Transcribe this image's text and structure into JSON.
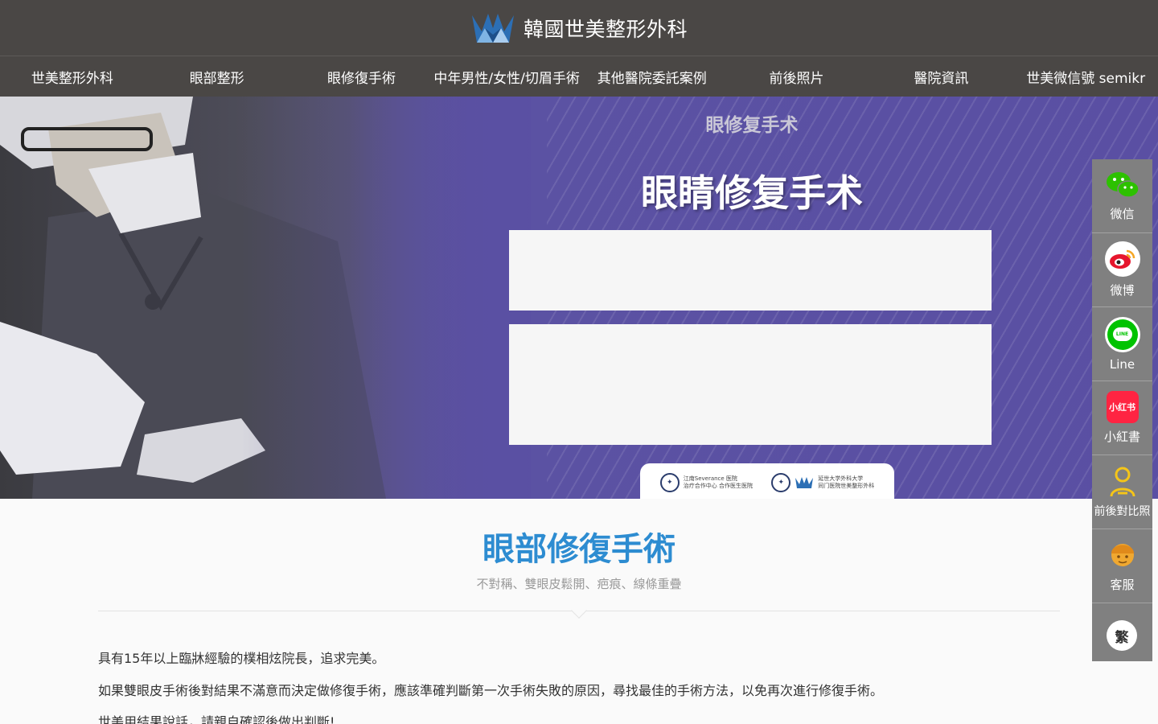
{
  "header": {
    "brand_name": "韓國世美整形外科",
    "logo_icon": "crown-logo-icon"
  },
  "nav": {
    "items": [
      {
        "label": "世美整形外科"
      },
      {
        "label": "眼部整形"
      },
      {
        "label": "眼修復手術"
      },
      {
        "label": "中年男性/女性/切眉手術"
      },
      {
        "label": "其他醫院委託案例"
      },
      {
        "label": "前後照片"
      },
      {
        "label": "醫院資訊"
      },
      {
        "label": "世美微信號 semikr"
      }
    ]
  },
  "hero": {
    "kicker": "眼修复手术",
    "title": "眼睛修复手术",
    "partners": [
      {
        "name": "江南Severance 医院",
        "line2": "治疗合作中心 合作医生医院"
      },
      {
        "name": "延世大学外科大学",
        "line2": "同门医院世美整形外科"
      }
    ]
  },
  "section": {
    "title": "眼部修復手術",
    "subtitle": "不對稱、雙眼皮鬆開、疤痕、線條重疊",
    "paragraphs": [
      "具有15年以上臨牀經驗的樸相炫院長，追求完美。",
      "如果雙眼皮手術後對結果不滿意而決定做修復手術，應該準確判斷第一次手術失敗的原因，尋找最佳的手術方法，以免再次進行修復手術。",
      "世美用結果說話，請親自確認後做出判斷!"
    ]
  },
  "sidebar": {
    "items": [
      {
        "label": "微信",
        "icon": "wechat-icon"
      },
      {
        "label": "微博",
        "icon": "weibo-icon"
      },
      {
        "label": "Line",
        "icon": "line-icon"
      },
      {
        "label": "小紅書",
        "icon": "xiaohongshu-icon",
        "badge": "小红书"
      },
      {
        "label": "前後對比照",
        "icon": "person-icon"
      },
      {
        "label": "客服",
        "icon": "customer-service-icon"
      }
    ],
    "lang_button": "繁"
  },
  "colors": {
    "header_bg": "#4a4745",
    "hero_purple": "#5a4fa3",
    "section_title": "#2d8cd1",
    "sidebar_bg": "#808080"
  }
}
